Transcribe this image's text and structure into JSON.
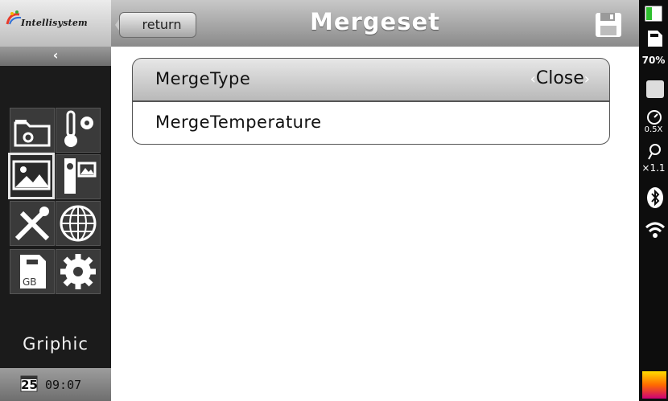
{
  "brand": {
    "logo_text": "Intellisystem"
  },
  "header": {
    "return_label": "return",
    "title": "Mergeset"
  },
  "settings": {
    "rows": [
      {
        "label": "MergeType",
        "value": "Close"
      },
      {
        "label": "MergeTemperature"
      }
    ]
  },
  "sidebar": {
    "tiles": [
      "folder-settings-icon",
      "thermometer-settings-icon",
      "image-icon",
      "camera-image-icon",
      "tools-icon",
      "globe-icon",
      "sd-card-icon",
      "gear-icon"
    ],
    "selected_tile": "image-icon",
    "section_label": "Griphic",
    "date_day": "25",
    "time": "09:07"
  },
  "status": {
    "storage_percent": "70%",
    "zoom_a": "0.5X",
    "zoom_b": "×1.1"
  },
  "colors": {
    "accent_gradient_top": "#ffdd00",
    "accent_gradient_bottom": "#cc0077"
  }
}
